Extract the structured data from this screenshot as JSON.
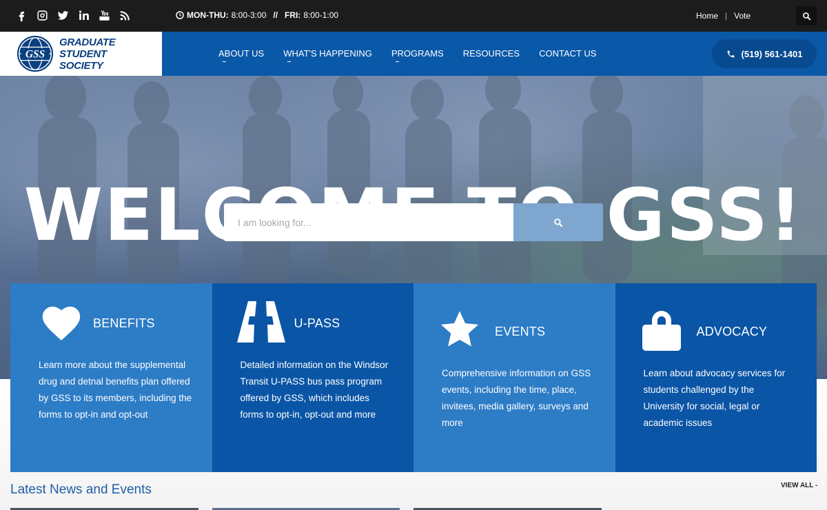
{
  "topbar": {
    "social_icons": [
      "facebook-icon",
      "instagram-icon",
      "twitter-icon",
      "linkedin-icon",
      "youtube-icon",
      "rss-icon"
    ],
    "hours_label_1": "MON-THU:",
    "hours_value_1": "8:00-3:00",
    "hours_sep": "//",
    "hours_label_2": "FRI:",
    "hours_value_2": "8:00-1:00",
    "links": {
      "home": "Home",
      "separator": "|",
      "vote": "Vote"
    }
  },
  "header": {
    "logo_line1": "GRADUATE",
    "logo_line2": "STUDENT",
    "logo_line3": "SOCIETY",
    "logo_mark": "GSS",
    "nav": {
      "about": "ABOUT US",
      "happening": "WHAT'S HAPPENING",
      "programs": "PROGRAMS",
      "resources": "RESOURCES",
      "contact": "CONTACT US"
    },
    "phone": "(519) 561-1401"
  },
  "hero": {
    "title": "WELCOME TO GSS!",
    "search_placeholder": "I am looking for..."
  },
  "cards": [
    {
      "title": "BENEFITS",
      "icon": "heart-icon",
      "desc": "Learn more about the supplemental drug and detnal benefits plan offered by GSS to its members, including the forms to opt-in and opt-out"
    },
    {
      "title": "U-PASS",
      "icon": "road-icon",
      "desc": "Detailed information on the Windsor Transit U-PASS bus pass program offered by GSS, which includes forms to opt-in, opt-out and more"
    },
    {
      "title": "EVENTS",
      "icon": "star-icon",
      "desc": "Comprehensive information on GSS events, including the time, place, invitees, media gallery, surveys and more"
    },
    {
      "title": "ADVOCACY",
      "icon": "lock-icon",
      "desc": "Learn about advocacy services for students challenged by the University for social, legal or academic issues"
    }
  ],
  "news": {
    "title": "Latest News and Events",
    "view_all": "VIEW ALL -"
  },
  "colors": {
    "topbar": "#1c1c1c",
    "header": "#0a58a8",
    "card_light": "#2d7cc6",
    "card_dark": "#0a55a6",
    "search_button": "#7fa6cf",
    "news_title": "#1f5da3"
  }
}
